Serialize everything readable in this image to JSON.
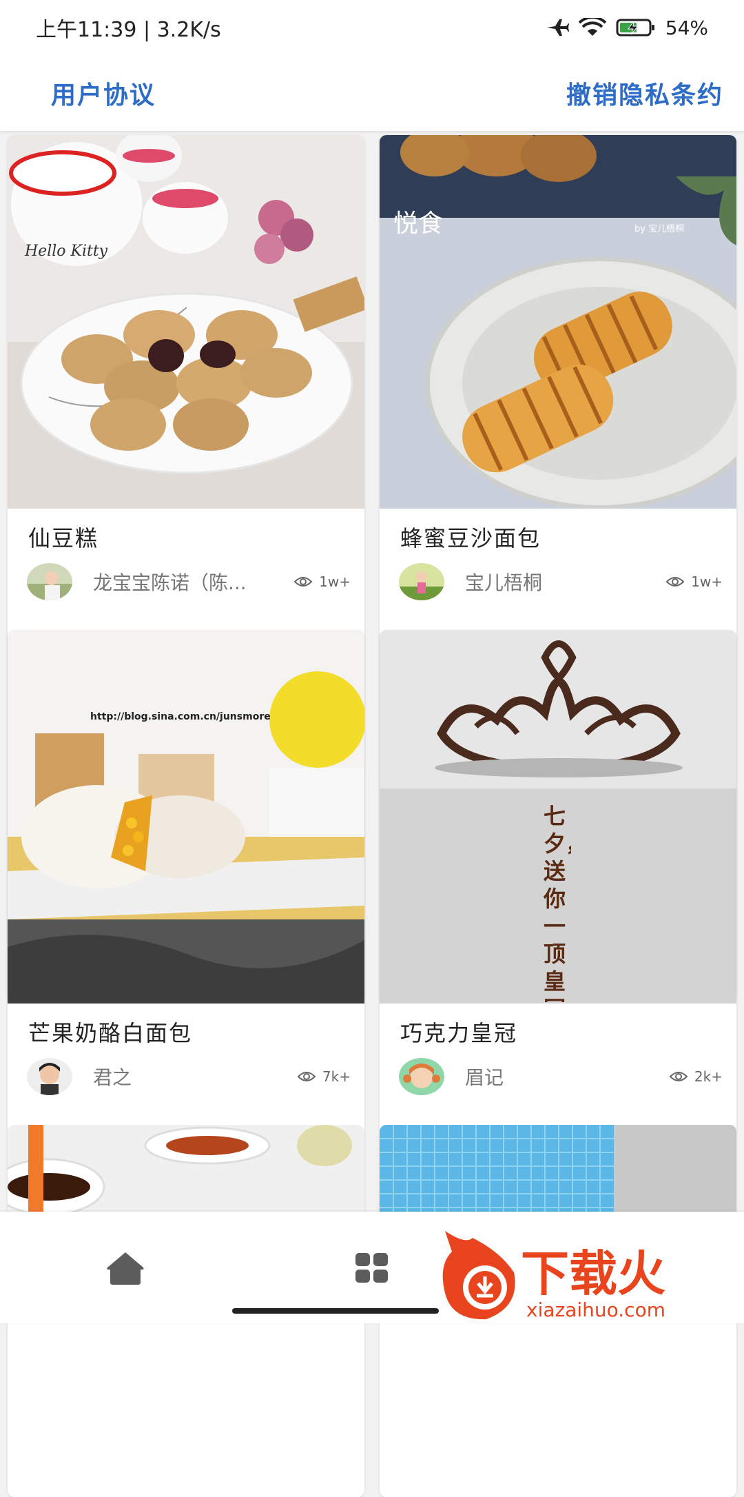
{
  "status": {
    "time": "上午11:39 | 3.2K/s",
    "battery": "54%",
    "icons": [
      "airplane-icon",
      "wifi-icon",
      "battery-icon"
    ]
  },
  "topbar": {
    "left_link": "用户协议",
    "right_link": "撤销隐私条约"
  },
  "recipes": [
    {
      "title": "仙豆糕",
      "author": "龙宝宝陈诺（陈...",
      "views": "1w+"
    },
    {
      "title": "蜂蜜豆沙面包",
      "author": "宝儿梧桐",
      "views": "1w+"
    },
    {
      "title": "芒果奶酪白面包",
      "author": "君之",
      "views": "7k+"
    },
    {
      "title": "巧克力皇冠",
      "author": "眉记",
      "views": "2k+"
    }
  ],
  "photo_text": {
    "kitty": "Hello Kitty",
    "yueshi": "悦食",
    "byline": "by 宝儿梧桐",
    "blog": "http://blog.sina.com.cn/junsmore",
    "qixi": "七夕，送你一顶皇冠"
  },
  "nav": {
    "items": [
      "home-icon",
      "category-icon"
    ]
  },
  "watermark": {
    "brand": "下载火",
    "url": "xiazaihuo.com"
  },
  "colors": {
    "accent": "#2d6cc7",
    "watermark": "#e8451e"
  }
}
